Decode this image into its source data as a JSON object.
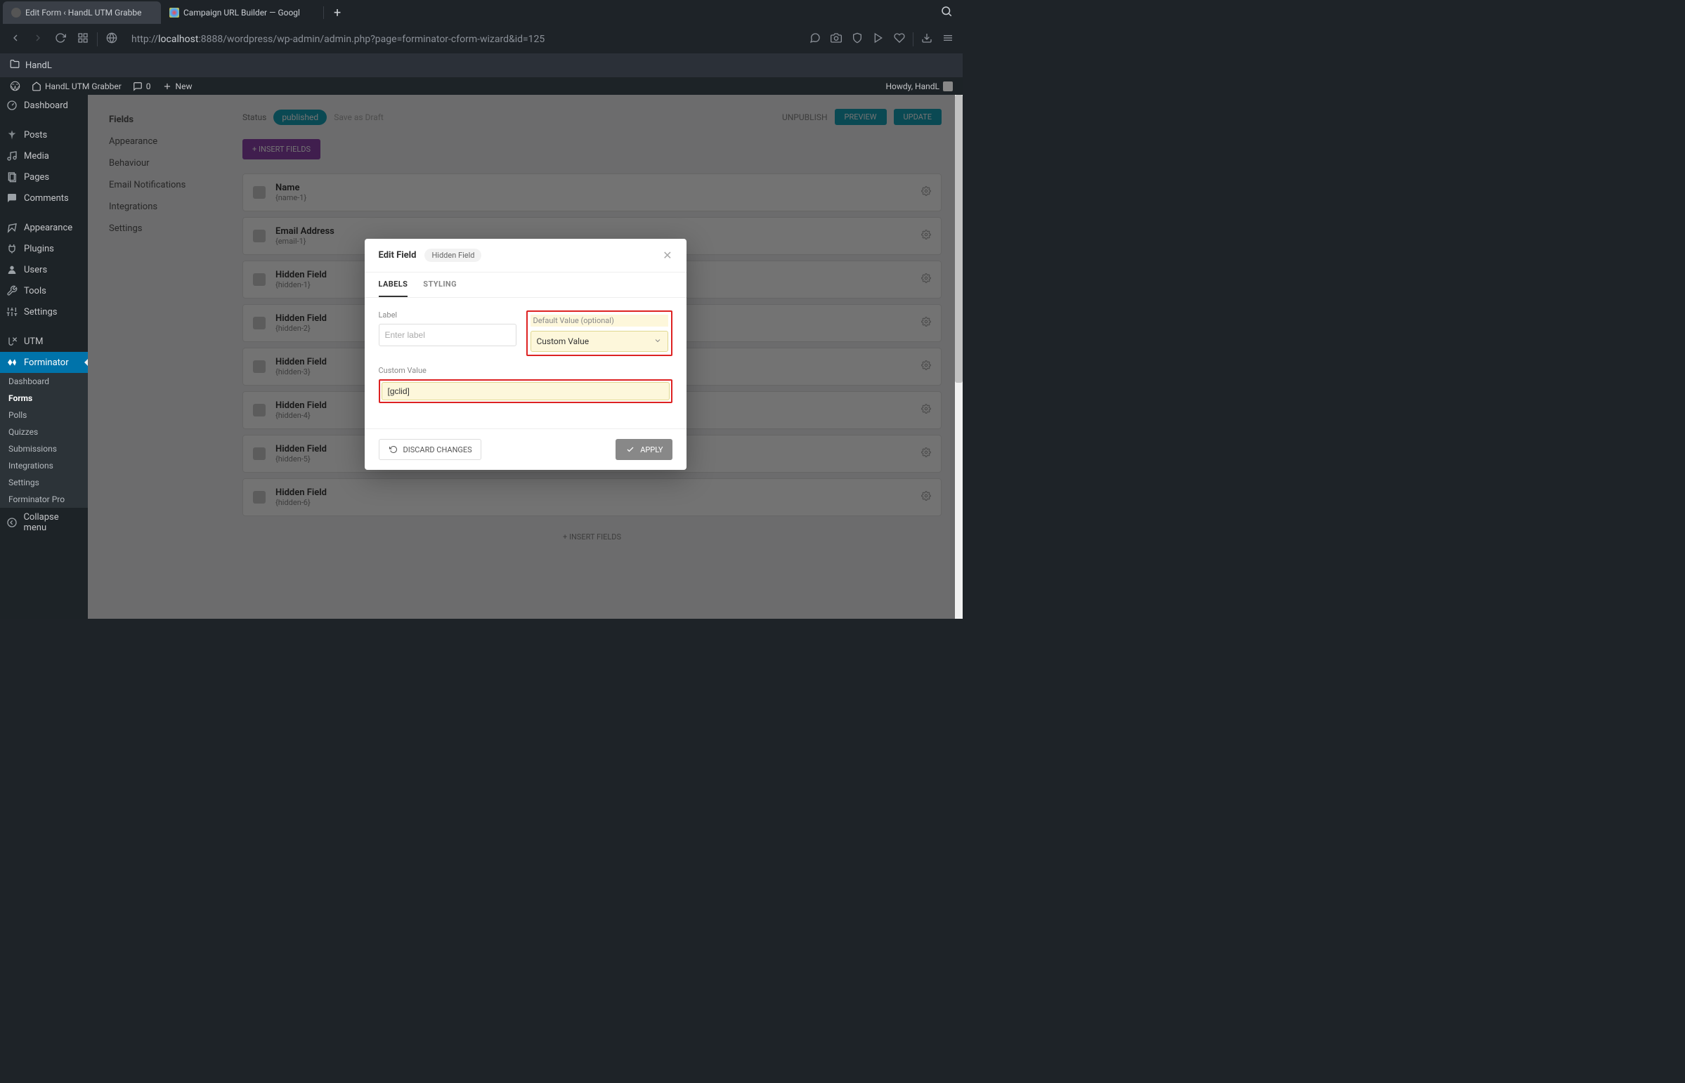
{
  "browser": {
    "tabs": [
      {
        "title": "Edit Form ‹ HandL UTM Grabbe",
        "active": true
      },
      {
        "title": "Campaign URL Builder — Googl",
        "active": false
      }
    ],
    "url_prefix": "http://",
    "url_host": "localhost",
    "url_path": ":8888/wordpress/wp-admin/admin.php?page=forminator-cform-wizard&id=125",
    "bookmark_folder": "HandL"
  },
  "adminbar": {
    "site_name": "HandL UTM Grabber",
    "comments_count": "0",
    "new_label": "New",
    "howdy": "Howdy, HandL"
  },
  "sidebar": {
    "items": [
      {
        "label": "Dashboard",
        "icon": "dashboard"
      },
      {
        "label": "Posts",
        "icon": "pin"
      },
      {
        "label": "Media",
        "icon": "media"
      },
      {
        "label": "Pages",
        "icon": "pages"
      },
      {
        "label": "Comments",
        "icon": "comments"
      },
      {
        "label": "Appearance",
        "icon": "appearance"
      },
      {
        "label": "Plugins",
        "icon": "plugins"
      },
      {
        "label": "Users",
        "icon": "users"
      },
      {
        "label": "Tools",
        "icon": "tools"
      },
      {
        "label": "Settings",
        "icon": "settings"
      },
      {
        "label": "UTM",
        "icon": "utm"
      },
      {
        "label": "Forminator",
        "icon": "forminator",
        "highlight": true
      }
    ],
    "submenu": [
      {
        "label": "Dashboard"
      },
      {
        "label": "Forms",
        "active": true
      },
      {
        "label": "Polls"
      },
      {
        "label": "Quizzes"
      },
      {
        "label": "Submissions"
      },
      {
        "label": "Integrations"
      },
      {
        "label": "Settings"
      },
      {
        "label": "Forminator Pro"
      }
    ],
    "collapse_label": "Collapse menu"
  },
  "bg": {
    "steps": [
      "Fields",
      "Appearance",
      "Behaviour",
      "Email Notifications",
      "Integrations",
      "Settings"
    ],
    "status_label": "Status",
    "status_value": "published",
    "save_draft": "Save as Draft",
    "unpublish": "UNPUBLISH",
    "preview": "PREVIEW",
    "update": "UPDATE",
    "insert_fields": "INSERT FIELDS",
    "insert_fields2": "INSERT FIELDS",
    "fields": [
      {
        "title": "Name",
        "sub": "{name-1}"
      },
      {
        "title": "Email Address",
        "sub": "{email-1}"
      },
      {
        "title": "Hidden Field",
        "sub": "{hidden-1}"
      },
      {
        "title": "Hidden Field",
        "sub": "{hidden-2}"
      },
      {
        "title": "Hidden Field",
        "sub": "{hidden-3}"
      },
      {
        "title": "Hidden Field",
        "sub": "{hidden-4}"
      },
      {
        "title": "Hidden Field",
        "sub": "{hidden-5}"
      },
      {
        "title": "Hidden Field",
        "sub": "{hidden-6}"
      }
    ]
  },
  "modal": {
    "title": "Edit Field",
    "badge": "Hidden Field",
    "tabs": {
      "labels": "LABELS",
      "styling": "STYLING"
    },
    "label_label": "Label",
    "label_placeholder": "Enter label",
    "label_value": "",
    "default_label": "Default Value (optional)",
    "default_value": "Custom Value",
    "custom_label": "Custom Value",
    "custom_value": "[gclid]",
    "discard": "DISCARD CHANGES",
    "apply": "APPLY"
  }
}
